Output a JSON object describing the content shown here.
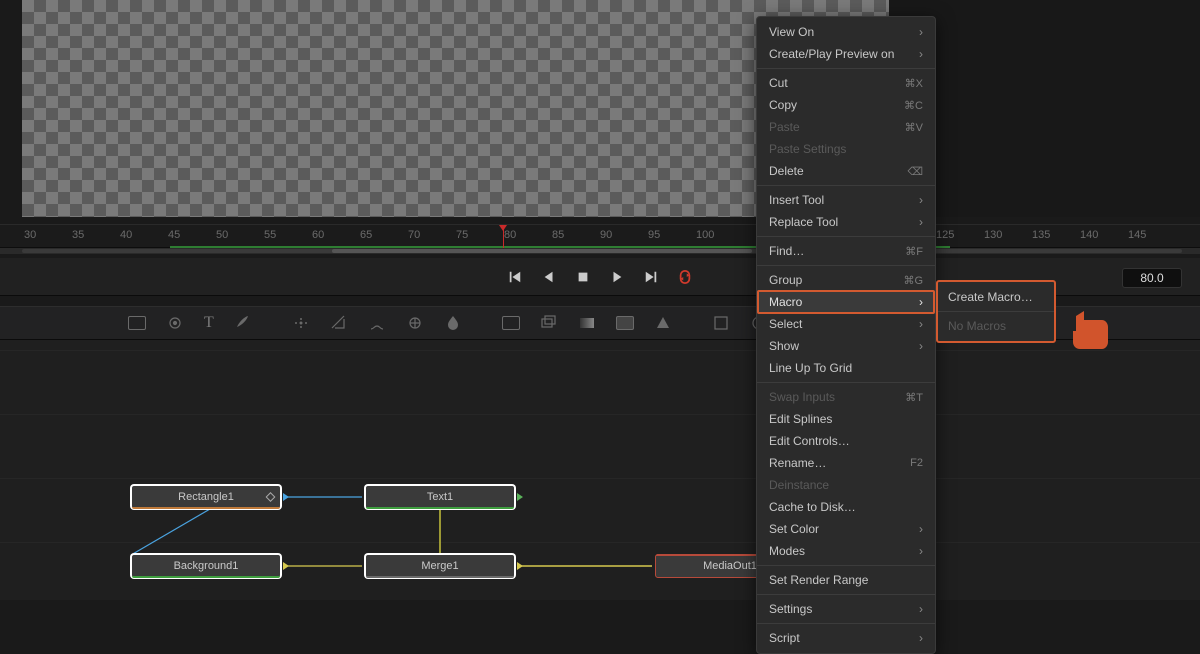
{
  "viewer": {},
  "ruler": {
    "ticks": [
      "30",
      "35",
      "40",
      "45",
      "50",
      "55",
      "60",
      "65",
      "70",
      "75",
      "80",
      "85",
      "90",
      "95",
      "100",
      "125",
      "130",
      "135",
      "140",
      "145"
    ]
  },
  "transport": {
    "frame_display": "80.0"
  },
  "toolbar": {
    "icons": [
      "media-in",
      "tracker",
      "text",
      "paint",
      "particles",
      "erode",
      "brush",
      "color",
      "blur",
      "mask-rect",
      "mask-ellipse",
      "mask-poly",
      "mask-triangle",
      "transform",
      "corner",
      "resize",
      "merge",
      "matte-a",
      "matte-b",
      "3d-cube",
      "light",
      "sphere"
    ]
  },
  "nodes": {
    "rectangle": "Rectangle1",
    "background": "Background1",
    "text": "Text1",
    "merge": "Merge1",
    "mediaout": "MediaOut1"
  },
  "context_menu": {
    "items": [
      {
        "label": "View On",
        "arrow": true
      },
      {
        "label": "Create/Play Preview on",
        "arrow": true
      },
      {
        "sep": true
      },
      {
        "label": "Cut",
        "shortcut": "⌘X"
      },
      {
        "label": "Copy",
        "shortcut": "⌘C"
      },
      {
        "label": "Paste",
        "shortcut": "⌘V",
        "disabled": true
      },
      {
        "label": "Paste Settings",
        "disabled": true
      },
      {
        "label": "Delete",
        "shortcut": "⌫"
      },
      {
        "sep": true
      },
      {
        "label": "Insert Tool",
        "arrow": true
      },
      {
        "label": "Replace Tool",
        "arrow": true
      },
      {
        "sep": true
      },
      {
        "label": "Find…",
        "shortcut": "⌘F"
      },
      {
        "sep": true
      },
      {
        "label": "Group",
        "shortcut": "⌘G"
      },
      {
        "label": "Macro",
        "arrow": true,
        "highlight": true
      },
      {
        "label": "Select",
        "arrow": true
      },
      {
        "label": "Show",
        "arrow": true
      },
      {
        "label": "Line Up To Grid"
      },
      {
        "sep": true
      },
      {
        "label": "Swap Inputs",
        "shortcut": "⌘T",
        "disabled": true
      },
      {
        "label": "Edit Splines"
      },
      {
        "label": "Edit Controls…"
      },
      {
        "label": "Rename…",
        "shortcut": "F2"
      },
      {
        "label": "Deinstance",
        "disabled": true
      },
      {
        "label": "Cache to Disk…"
      },
      {
        "label": "Set Color",
        "arrow": true
      },
      {
        "label": "Modes",
        "arrow": true
      },
      {
        "sep": true
      },
      {
        "label": "Set Render Range"
      },
      {
        "sep": true
      },
      {
        "label": "Settings",
        "arrow": true
      },
      {
        "sep": true
      },
      {
        "label": "Script",
        "arrow": true
      }
    ]
  },
  "submenu": {
    "create": "Create Macro…",
    "none": "No Macros"
  },
  "colors": {
    "highlight_orange": "#d35a30"
  }
}
